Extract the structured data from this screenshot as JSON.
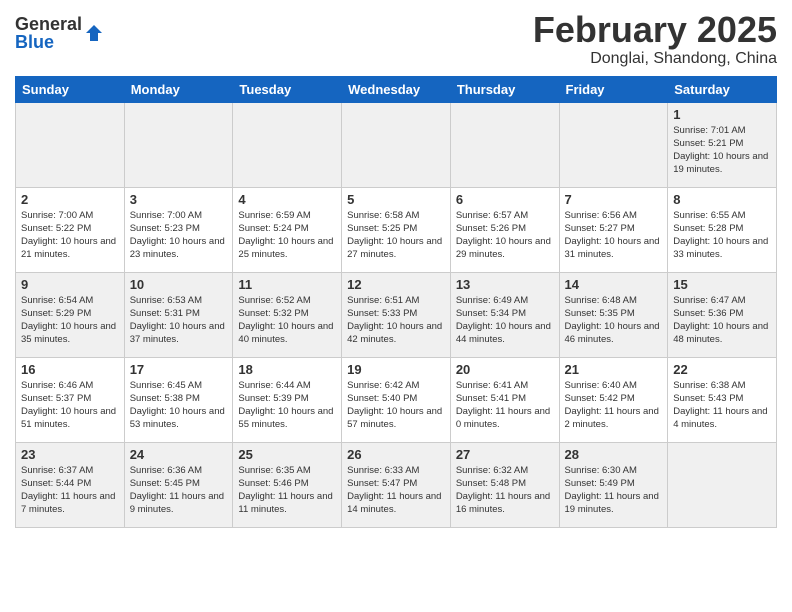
{
  "header": {
    "logo_general": "General",
    "logo_blue": "Blue",
    "month_title": "February 2025",
    "location": "Donglai, Shandong, China"
  },
  "days_of_week": [
    "Sunday",
    "Monday",
    "Tuesday",
    "Wednesday",
    "Thursday",
    "Friday",
    "Saturday"
  ],
  "weeks": [
    {
      "days": [
        {
          "number": "",
          "info": ""
        },
        {
          "number": "",
          "info": ""
        },
        {
          "number": "",
          "info": ""
        },
        {
          "number": "",
          "info": ""
        },
        {
          "number": "",
          "info": ""
        },
        {
          "number": "",
          "info": ""
        },
        {
          "number": "1",
          "info": "Sunrise: 7:01 AM\nSunset: 5:21 PM\nDaylight: 10 hours\nand 19 minutes."
        }
      ]
    },
    {
      "days": [
        {
          "number": "2",
          "info": "Sunrise: 7:00 AM\nSunset: 5:22 PM\nDaylight: 10 hours\nand 21 minutes."
        },
        {
          "number": "3",
          "info": "Sunrise: 7:00 AM\nSunset: 5:23 PM\nDaylight: 10 hours\nand 23 minutes."
        },
        {
          "number": "4",
          "info": "Sunrise: 6:59 AM\nSunset: 5:24 PM\nDaylight: 10 hours\nand 25 minutes."
        },
        {
          "number": "5",
          "info": "Sunrise: 6:58 AM\nSunset: 5:25 PM\nDaylight: 10 hours\nand 27 minutes."
        },
        {
          "number": "6",
          "info": "Sunrise: 6:57 AM\nSunset: 5:26 PM\nDaylight: 10 hours\nand 29 minutes."
        },
        {
          "number": "7",
          "info": "Sunrise: 6:56 AM\nSunset: 5:27 PM\nDaylight: 10 hours\nand 31 minutes."
        },
        {
          "number": "8",
          "info": "Sunrise: 6:55 AM\nSunset: 5:28 PM\nDaylight: 10 hours\nand 33 minutes."
        }
      ]
    },
    {
      "days": [
        {
          "number": "9",
          "info": "Sunrise: 6:54 AM\nSunset: 5:29 PM\nDaylight: 10 hours\nand 35 minutes."
        },
        {
          "number": "10",
          "info": "Sunrise: 6:53 AM\nSunset: 5:31 PM\nDaylight: 10 hours\nand 37 minutes."
        },
        {
          "number": "11",
          "info": "Sunrise: 6:52 AM\nSunset: 5:32 PM\nDaylight: 10 hours\nand 40 minutes."
        },
        {
          "number": "12",
          "info": "Sunrise: 6:51 AM\nSunset: 5:33 PM\nDaylight: 10 hours\nand 42 minutes."
        },
        {
          "number": "13",
          "info": "Sunrise: 6:49 AM\nSunset: 5:34 PM\nDaylight: 10 hours\nand 44 minutes."
        },
        {
          "number": "14",
          "info": "Sunrise: 6:48 AM\nSunset: 5:35 PM\nDaylight: 10 hours\nand 46 minutes."
        },
        {
          "number": "15",
          "info": "Sunrise: 6:47 AM\nSunset: 5:36 PM\nDaylight: 10 hours\nand 48 minutes."
        }
      ]
    },
    {
      "days": [
        {
          "number": "16",
          "info": "Sunrise: 6:46 AM\nSunset: 5:37 PM\nDaylight: 10 hours\nand 51 minutes."
        },
        {
          "number": "17",
          "info": "Sunrise: 6:45 AM\nSunset: 5:38 PM\nDaylight: 10 hours\nand 53 minutes."
        },
        {
          "number": "18",
          "info": "Sunrise: 6:44 AM\nSunset: 5:39 PM\nDaylight: 10 hours\nand 55 minutes."
        },
        {
          "number": "19",
          "info": "Sunrise: 6:42 AM\nSunset: 5:40 PM\nDaylight: 10 hours\nand 57 minutes."
        },
        {
          "number": "20",
          "info": "Sunrise: 6:41 AM\nSunset: 5:41 PM\nDaylight: 11 hours\nand 0 minutes."
        },
        {
          "number": "21",
          "info": "Sunrise: 6:40 AM\nSunset: 5:42 PM\nDaylight: 11 hours\nand 2 minutes."
        },
        {
          "number": "22",
          "info": "Sunrise: 6:38 AM\nSunset: 5:43 PM\nDaylight: 11 hours\nand 4 minutes."
        }
      ]
    },
    {
      "days": [
        {
          "number": "23",
          "info": "Sunrise: 6:37 AM\nSunset: 5:44 PM\nDaylight: 11 hours\nand 7 minutes."
        },
        {
          "number": "24",
          "info": "Sunrise: 6:36 AM\nSunset: 5:45 PM\nDaylight: 11 hours\nand 9 minutes."
        },
        {
          "number": "25",
          "info": "Sunrise: 6:35 AM\nSunset: 5:46 PM\nDaylight: 11 hours\nand 11 minutes."
        },
        {
          "number": "26",
          "info": "Sunrise: 6:33 AM\nSunset: 5:47 PM\nDaylight: 11 hours\nand 14 minutes."
        },
        {
          "number": "27",
          "info": "Sunrise: 6:32 AM\nSunset: 5:48 PM\nDaylight: 11 hours\nand 16 minutes."
        },
        {
          "number": "28",
          "info": "Sunrise: 6:30 AM\nSunset: 5:49 PM\nDaylight: 11 hours\nand 19 minutes."
        },
        {
          "number": "",
          "info": ""
        }
      ]
    }
  ]
}
